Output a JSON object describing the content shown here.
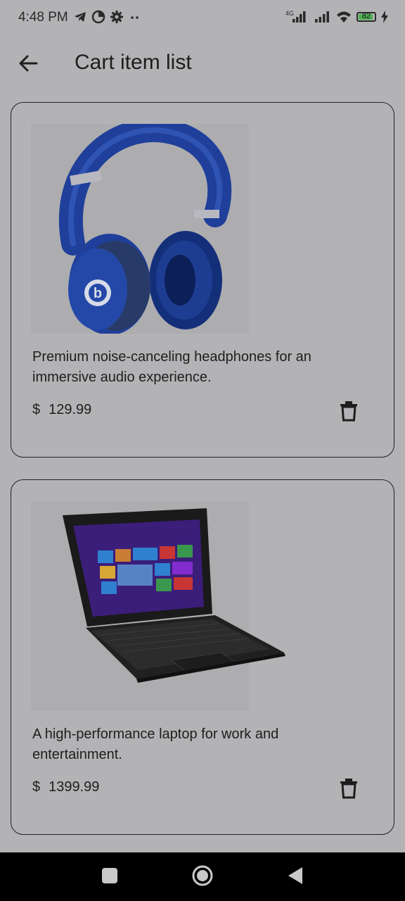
{
  "status_bar": {
    "time": "4:48 PM",
    "battery": "82",
    "network": "4G",
    "icons": [
      "telegram-icon",
      "data-saver-icon",
      "settings-icon",
      "more-dots-icon",
      "signal-icon",
      "signal-icon",
      "wifi-icon",
      "battery-icon",
      "charging-icon"
    ]
  },
  "app_bar": {
    "title": "Cart item list",
    "back_icon": "arrow-back-icon"
  },
  "cart_items": [
    {
      "image": "headphones-image",
      "description": "Premium noise-canceling headphones for an immersive audio experience.",
      "currency": "$",
      "price": "129.99",
      "delete_icon": "trash-icon"
    },
    {
      "image": "laptop-image",
      "description": "A high-performance laptop for work and entertainment.",
      "currency": "$",
      "price": "1399.99",
      "delete_icon": "trash-icon"
    }
  ],
  "nav_bar": {
    "icons": [
      "recents-square-icon",
      "home-circle-icon",
      "back-triangle-icon"
    ]
  },
  "colors": {
    "background": "#b3b3b6",
    "card_border": "#222222",
    "text": "#1e1e1e",
    "battery_fill": "#4caf50",
    "headphones_blue": "#1f3f9a",
    "nav_bar": "#000000"
  }
}
